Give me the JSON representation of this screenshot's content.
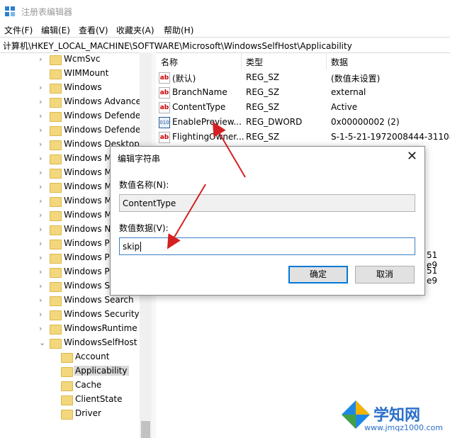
{
  "window": {
    "title": "注册表编辑器"
  },
  "menu": [
    "文件(F)",
    "编辑(E)",
    "查看(V)",
    "收藏夹(A)",
    "帮助(H)"
  ],
  "address": "计算机\\HKEY_LOCAL_MACHINE\\SOFTWARE\\Microsoft\\WindowsSelfHost\\Applicability",
  "tree": [
    "WcmSvc",
    "WIMMount",
    "Windows",
    "Windows Advance",
    "Windows Defende",
    "Windows Defende",
    "Windows Desktop",
    "Windows M",
    "Windows M",
    "Windows M",
    "Windows M",
    "Windows M",
    "Windows N",
    "Windows Po",
    "Windows Ph",
    "Windows Po",
    "Windows Script Ho",
    "Windows Search",
    "Windows Security",
    "WindowsRuntime",
    "WindowsSelfHost",
    "Account",
    "Applicability",
    "Cache",
    "ClientState",
    "Driver"
  ],
  "columns": {
    "name": "名称",
    "type": "类型",
    "data": "数据"
  },
  "values": [
    {
      "name": "(默认)",
      "type": "REG_SZ",
      "data": "(数值未设置)",
      "icon": "string-value-icon"
    },
    {
      "name": "BranchName",
      "type": "REG_SZ",
      "data": "external",
      "icon": "string-value-icon"
    },
    {
      "name": "ContentType",
      "type": "REG_SZ",
      "data": "Active",
      "icon": "string-value-icon"
    },
    {
      "name": "EnablePreview...",
      "type": "REG_DWORD",
      "data": "0x00000002 (2)",
      "icon": "binary-value-icon"
    },
    {
      "name": "FlightingOwner...",
      "type": "REG_SZ",
      "data": "S-1-5-21-1972008444-31108",
      "icon": "string-value-icon"
    }
  ],
  "partial_data": [
    "51 e9",
    "51 e9"
  ],
  "dialog": {
    "title": "编辑字符串",
    "close_label": "✕",
    "name_label": "数值名称(N):",
    "name_value": "ContentType",
    "data_label": "数值数据(V):",
    "data_value": "skip",
    "ok_label": "确定",
    "cancel_label": "取消"
  },
  "watermark": {
    "title": "学知网",
    "url": "www.jmqz1000.com"
  }
}
